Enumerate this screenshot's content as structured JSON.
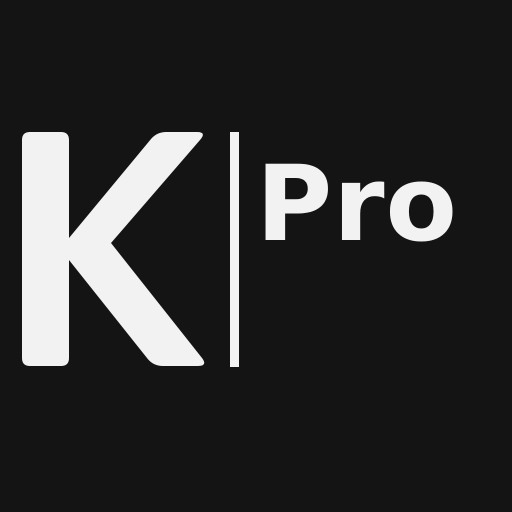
{
  "logo": {
    "mark_letter": "K",
    "suffix_text": "Pro",
    "brand_text": "K|Pro",
    "colors": {
      "background": "#141414",
      "foreground": "#f2f2f2"
    }
  }
}
